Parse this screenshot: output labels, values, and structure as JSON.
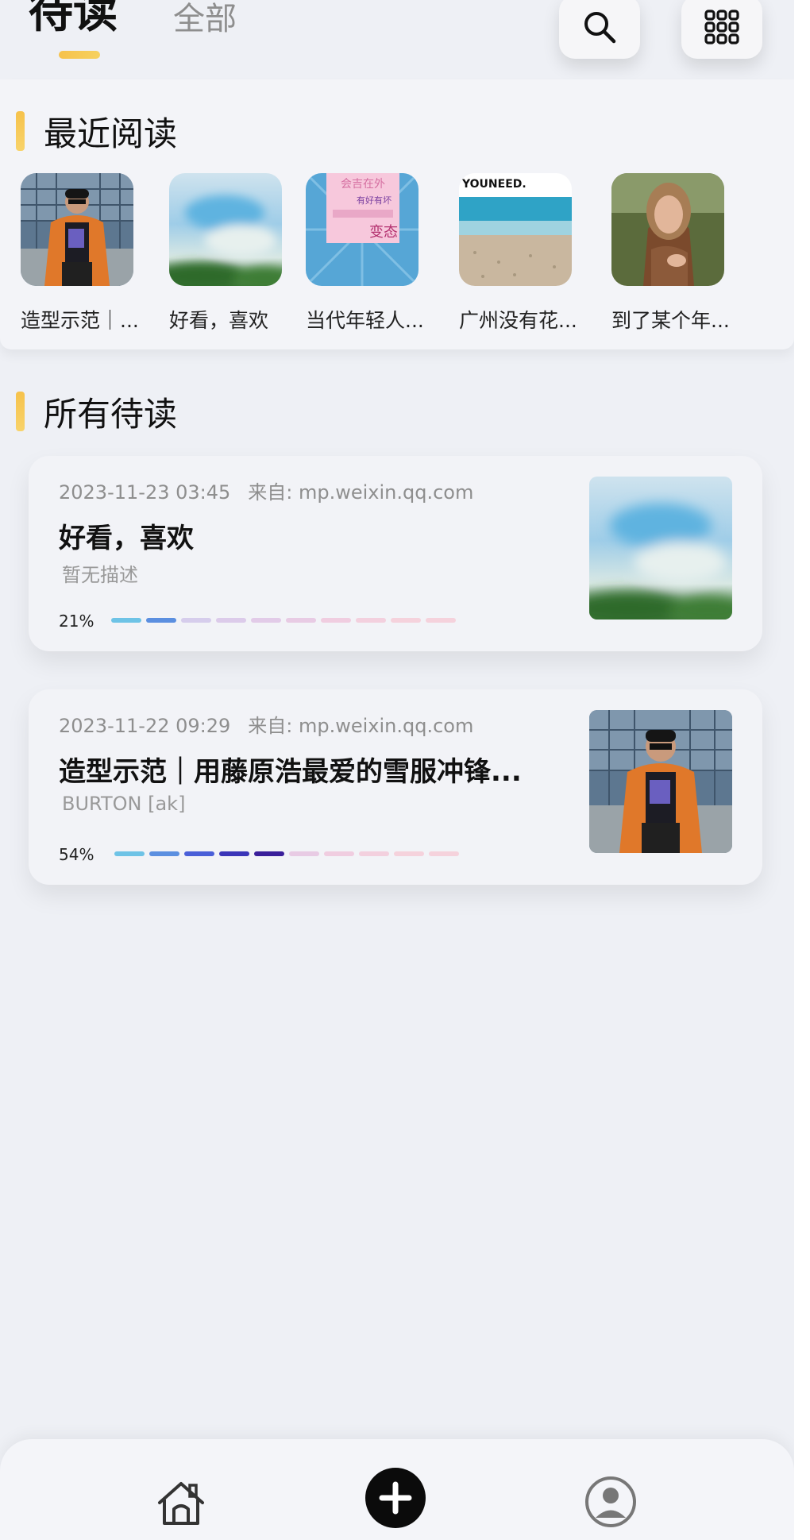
{
  "header": {
    "tab_active": "待读",
    "tab_all": "全部",
    "search_icon": "search-icon",
    "grid_icon": "grid-icon"
  },
  "recent": {
    "title": "最近阅读",
    "items": [
      {
        "label": "造型示范｜...",
        "thumb": "man-orange-jacket"
      },
      {
        "label": "好看，喜欢",
        "thumb": "blurred-blue-sky"
      },
      {
        "label": "当代年轻人...",
        "thumb": "pink-text-poster"
      },
      {
        "label": "广州没有花...",
        "thumb": "beach"
      },
      {
        "label": "到了某个年...",
        "thumb": "woman-portrait"
      }
    ],
    "poster_text": {
      "line1": "会吉在外",
      "line2": "有好有坏",
      "line3": "变态"
    },
    "beach_text": "YOUNEED."
  },
  "all": {
    "title": "所有待读",
    "cards": [
      {
        "date": "2023-11-23 03:45",
        "source": "来自: mp.weixin.qq.com",
        "title": "好看，喜欢",
        "desc": "暂无描述",
        "percent": "21%",
        "progress": 0.21,
        "thumb": "blurred-blue-sky"
      },
      {
        "date": "2023-11-22 09:29",
        "source": "来自: mp.weixin.qq.com",
        "title": "造型示范｜用藤原浩最爱的雪服冲锋...",
        "desc": "BURTON [ak]",
        "percent": "54%",
        "progress": 0.54,
        "thumb": "man-orange-jacket"
      }
    ]
  },
  "nav": {
    "home_icon": "home-icon",
    "add_icon": "add-icon",
    "profile_icon": "profile-icon"
  },
  "colors": {
    "accent": "#f6c24b",
    "background": "#eef0f5",
    "segment_filled": [
      "#6ec3e6",
      "#5b8fe0",
      "#4a5fd8",
      "#3b35b8",
      "#3a1f9a"
    ],
    "segment_empty": [
      "#d3daf2",
      "#d3d1ee",
      "#d6cdec",
      "#dccbea",
      "#e2cbe8",
      "#e8cbe4",
      "#f0cde0",
      "#f3d0de",
      "#f5d2dc"
    ]
  }
}
